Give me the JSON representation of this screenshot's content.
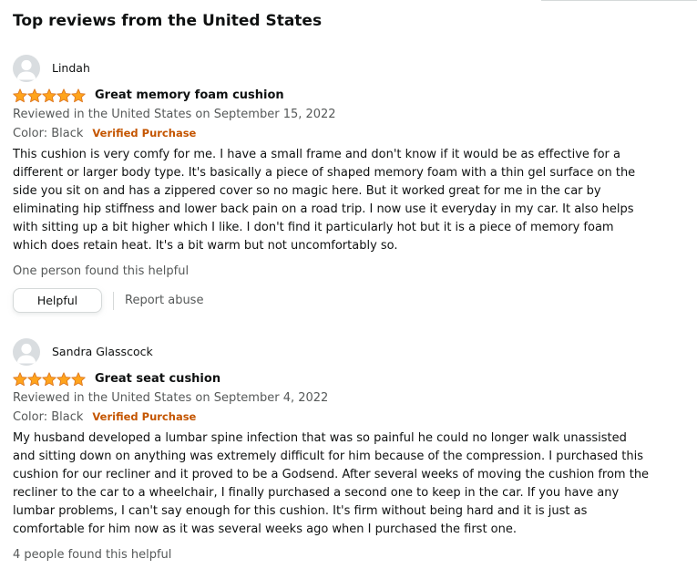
{
  "section": {
    "title": "Top reviews from the United States"
  },
  "colors": {
    "star": "#ffa41c",
    "verified": "#c45500",
    "muted_text": "#565959"
  },
  "reviews": [
    {
      "profile_name": "Lindah",
      "rating": 5,
      "rating_max": 5,
      "title": "Great memory foam cushion",
      "date": "Reviewed in the United States on September 15, 2022",
      "variant": "Color: Black",
      "verified": "Verified Purchase",
      "body_lines": [
        "This cushion is very comfy for me. I have a small frame and don't know if it would be as effective for a",
        "different or larger body type. It's basically a piece of shaped memory foam with a thin gel surface on the",
        "side you sit on and has a zippered cover so no magic here. But it worked great for me in the car by",
        "eliminating hip stiffness and lower back pain on a road trip. I now use it everyday in my car. It also helps",
        "with sitting up a bit higher which I like. I don't find it particularly hot but it is a piece of memory foam",
        "which does retain heat. It's a bit warm but not uncomfortably so."
      ],
      "helpful_count": "One person found this helpful",
      "helpful_label": "Helpful",
      "report_label": "Report abuse"
    },
    {
      "profile_name": "Sandra Glasscock",
      "rating": 5,
      "rating_max": 5,
      "title": "Great seat cushion",
      "date": "Reviewed in the United States on September 4, 2022",
      "variant": "Color: Black",
      "verified": "Verified Purchase",
      "body_lines": [
        "My husband developed a lumbar spine infection that was so painful he could no longer walk unassisted",
        "and sitting down on anything was extremely difficult for him because of the compression. I purchased this",
        "cushion for our recliner and it proved to be a Godsend. After several weeks of moving the cushion from the",
        "recliner to the car to a wheelchair, I finally purchased a second one to keep in the car. If you have any",
        "lumbar problems, I can't say enough for this cushion. It's firm without being hard and it is just as",
        "comfortable for him now as it was several weeks ago when I purchased the first one."
      ],
      "helpful_count": "4 people found this helpful"
    }
  ]
}
